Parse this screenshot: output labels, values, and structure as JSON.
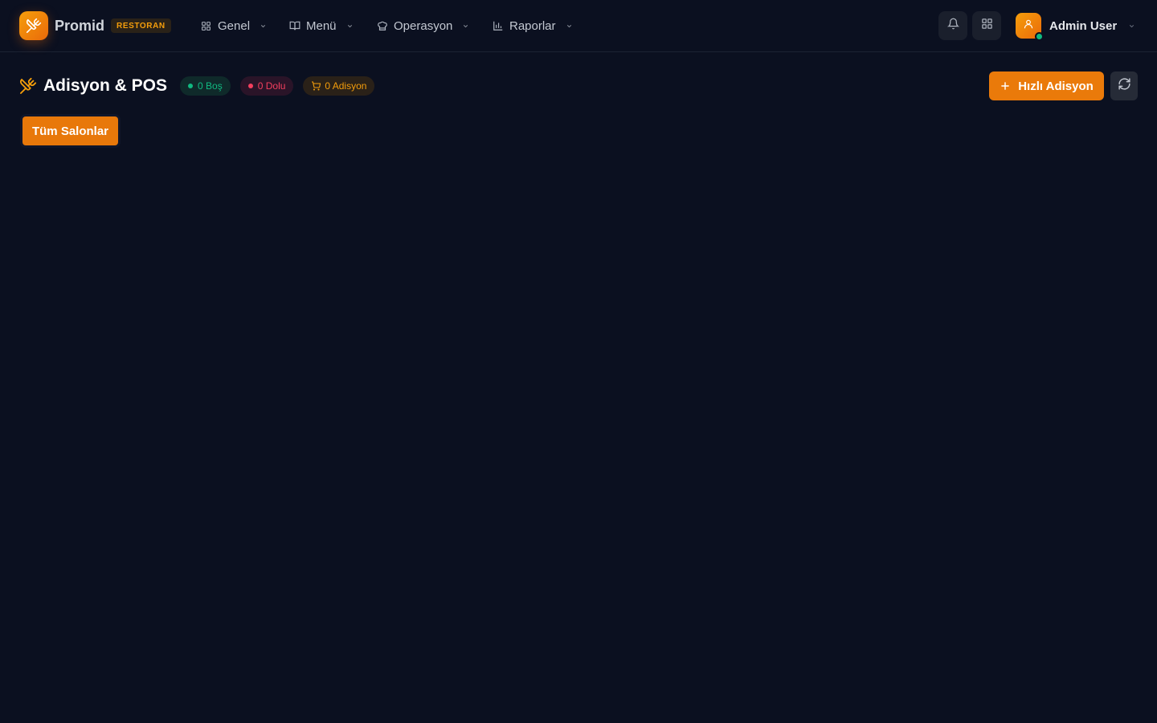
{
  "brand": {
    "name": "Promid",
    "tag": "RESTORAN"
  },
  "nav": [
    {
      "label": "Genel",
      "icon": "grid-icon"
    },
    {
      "label": "Menü",
      "icon": "book-open-icon"
    },
    {
      "label": "Operasyon",
      "icon": "chef-hat-icon"
    },
    {
      "label": "Raporlar",
      "icon": "bar-chart-icon"
    }
  ],
  "user": {
    "name": "Admin User",
    "status": "online"
  },
  "page": {
    "title": "Adisyon & POS",
    "stats": {
      "empty": "0 Boş",
      "full": "0 Dolu",
      "orders": "0 Adisyon"
    },
    "quick_order_label": "Hızlı Adisyon",
    "salon_tab_label": "Tüm Salonlar"
  },
  "colors": {
    "background": "#0b1020",
    "accent": "#ea7a0a",
    "empty_status": "#10b981",
    "full_status": "#f43f5e",
    "orders_status": "#f59e0b"
  }
}
